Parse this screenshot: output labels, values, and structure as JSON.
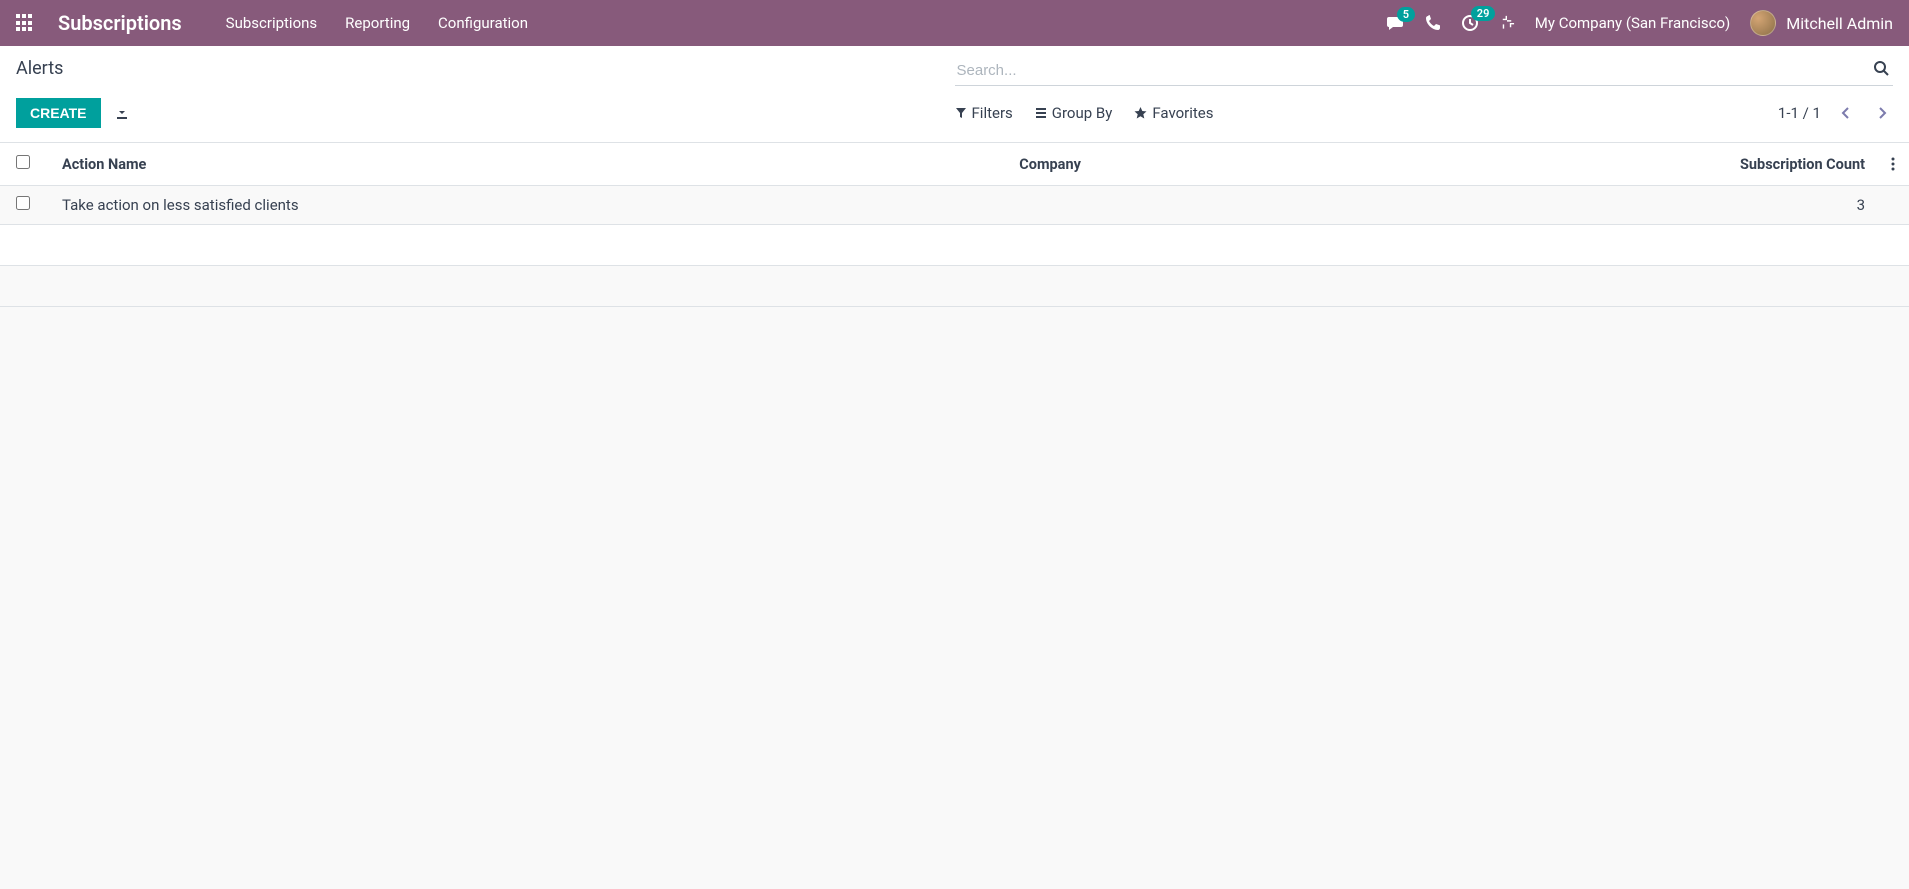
{
  "navbar": {
    "app_title": "Subscriptions",
    "menu": [
      "Subscriptions",
      "Reporting",
      "Configuration"
    ],
    "messages_badge": "5",
    "activities_badge": "29",
    "company": "My Company (San Francisco)",
    "user_name": "Mitchell Admin"
  },
  "breadcrumb": "Alerts",
  "search": {
    "placeholder": "Search..."
  },
  "buttons": {
    "create": "CREATE"
  },
  "search_options": {
    "filters": "Filters",
    "group_by": "Group By",
    "favorites": "Favorites"
  },
  "pager": "1-1 / 1",
  "table": {
    "headers": {
      "action_name": "Action Name",
      "company": "Company",
      "subscription_count": "Subscription Count"
    },
    "rows": [
      {
        "action_name": "Take action on less satisfied clients",
        "company": "",
        "subscription_count": "3"
      }
    ]
  }
}
